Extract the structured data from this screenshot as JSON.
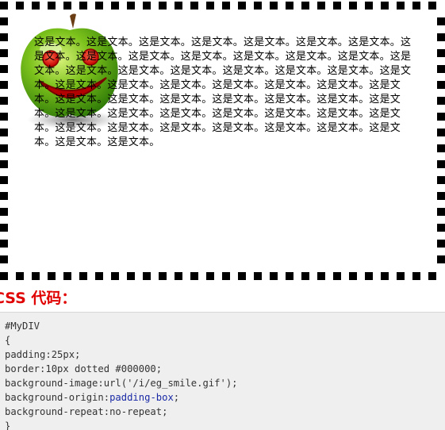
{
  "demo": {
    "text": "这是文本。这是文本。这是文本。这是文本。这是文本。这是文本。这是文本。这是文本。这是文本。这是文本。这是文本。这是文本。这是文本。这是文本。这是文本。这是文本。这是文本。这是文本。这是文本。这是文本。这是文本。这是文本。这是文本。这是文本。这是文本。这是文本。这是文本。这是文本。这是文本。这是文本。这是文本。这是文本。这是文本。这是文本。这是文本。这是文本。这是文本。这是文本。这是文本。这是文本。这是文本。这是文本。这是文本。这是文本。这是文本。这是文本。这是文本。这是文本。这是文本。这是文本。这是文本。这是文本。",
    "border_color": "#000000",
    "background_image": "apple-smile-icon"
  },
  "code_section": {
    "heading": "CSS 代码：",
    "heading_color": "#e00000",
    "lines": {
      "l1": "#MyDIV",
      "l2": "{",
      "l3": "padding:25px;",
      "l4": "border:10px dotted #000000;",
      "l5": "background-image:url('/i/eg_smile.gif');",
      "l6_prop": "background-origin:",
      "l6_val": "padding-box",
      "l6_end": ";",
      "l7": "background-repeat:no-repeat;",
      "l8": "}"
    }
  }
}
